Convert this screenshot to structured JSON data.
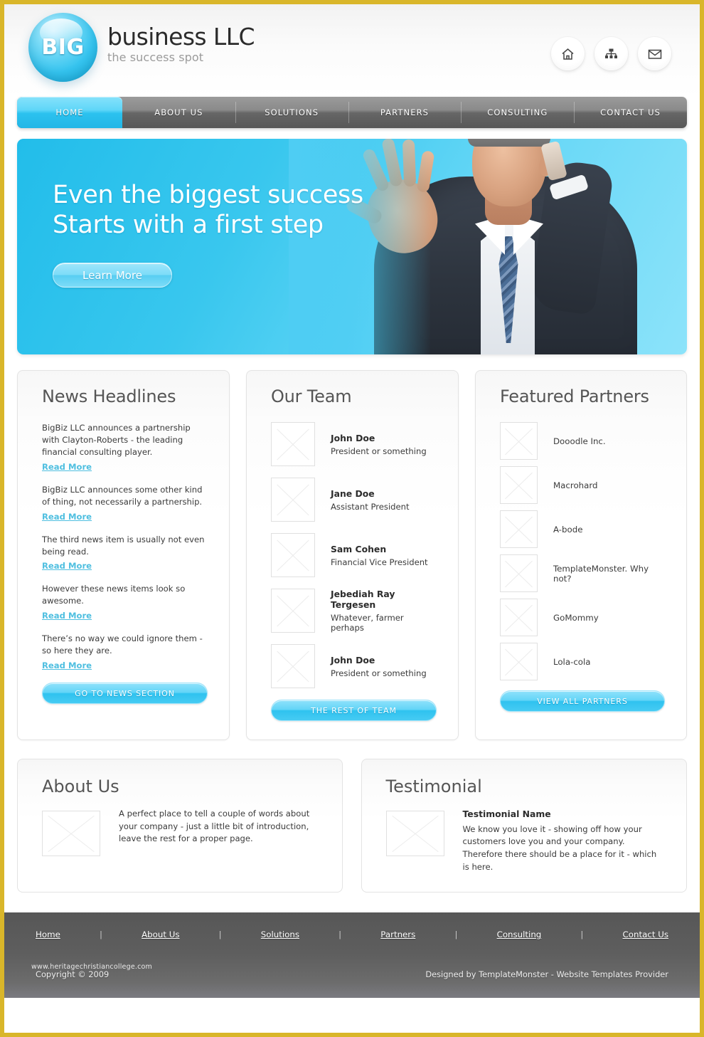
{
  "brand": {
    "orb_text": "BIG",
    "title": "business LLC",
    "tagline": "the success spot"
  },
  "header_icons": [
    {
      "name": "home-icon",
      "label": "Home"
    },
    {
      "name": "sitemap-icon",
      "label": "Site Map"
    },
    {
      "name": "mail-icon",
      "label": "Contact"
    }
  ],
  "nav": {
    "items": [
      {
        "label": "HOME",
        "active": true
      },
      {
        "label": "ABOUT US",
        "active": false
      },
      {
        "label": "SOLUTIONS",
        "active": false
      },
      {
        "label": "PARTNERS",
        "active": false
      },
      {
        "label": "CONSULTING",
        "active": false
      },
      {
        "label": "CONTACT US",
        "active": false
      }
    ]
  },
  "hero": {
    "line1": "Even the biggest success",
    "line2": "Starts with a first step",
    "button": "Learn More"
  },
  "news": {
    "title": "News Headlines",
    "items": [
      {
        "text": "BigBiz LLC announces a partnership with Clayton-Roberts - the leading financial consulting player.",
        "link": "Read More"
      },
      {
        "text": "BigBiz LLC announces some other kind of thing, not necessarily a partnership.",
        "link": "Read More"
      },
      {
        "text": "The third news item is usually not even being read.",
        "link": "Read More"
      },
      {
        "text": "However these news items look so awesome.",
        "link": "Read More"
      },
      {
        "text": "There’s no way  we could ignore them - so here they are.",
        "link": "Read More"
      }
    ],
    "button": "GO TO NEWS SECTION"
  },
  "team": {
    "title": "Our Team",
    "members": [
      {
        "name": "John Doe",
        "role": "President or something"
      },
      {
        "name": "Jane Doe",
        "role": "Assistant President"
      },
      {
        "name": "Sam Cohen",
        "role": "Financial Vice President"
      },
      {
        "name": "Jebediah Ray Tergesen",
        "role": "Whatever, farmer perhaps"
      },
      {
        "name": "John Doe",
        "role": "President or something"
      }
    ],
    "button": "THE REST OF TEAM"
  },
  "partners": {
    "title": "Featured Partners",
    "items": [
      {
        "name": "Dooodle Inc."
      },
      {
        "name": "Macrohard"
      },
      {
        "name": "A-bode"
      },
      {
        "name": "TemplateMonster. Why not?"
      },
      {
        "name": "GoMommy"
      },
      {
        "name": "Lola-cola"
      }
    ],
    "button": "VIEW ALL PARTNERS"
  },
  "about": {
    "title": "About Us",
    "text": "A perfect place to tell a couple of words about your company - just a little bit of introduction, leave the rest for a proper page."
  },
  "testimonial": {
    "title": "Testimonial",
    "name": "Testimonial Name",
    "text": "We know you love it - showing off how your customers love you and your company. Therefore there should be a place for it - which is here."
  },
  "footer": {
    "links": [
      "Home",
      "About Us",
      "Solutions",
      "Partners",
      "Consulting",
      "Contact Us"
    ],
    "separator": "|",
    "copyright": "Copyright © 2009",
    "credit": "Designed by TemplateMonster - Website Templates Provider",
    "watermark": "www.heritagechristiancollege.com"
  },
  "colors": {
    "accent": "#2cc2ef",
    "frame": "#d9b62a",
    "nav_dark": "#666666",
    "footer": "#5e5e5e",
    "link": "#4fbfe0"
  }
}
